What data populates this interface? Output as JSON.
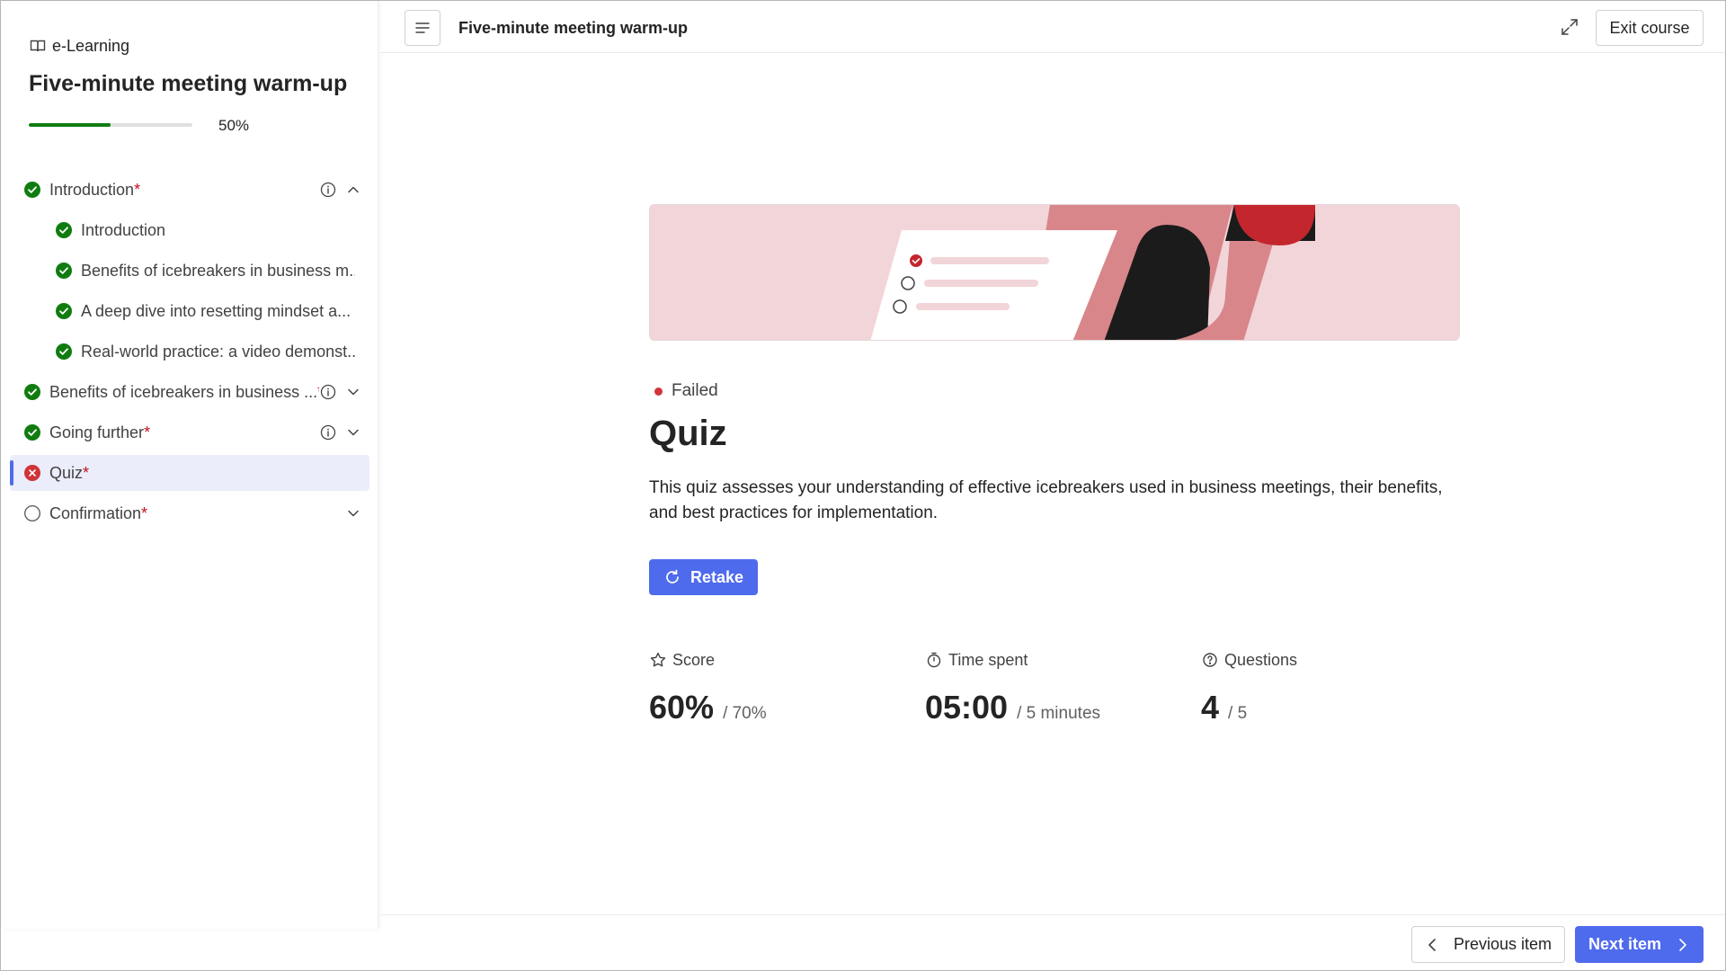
{
  "sidebar": {
    "brand_label": "e-Learning",
    "course_title": "Five-minute meeting warm-up",
    "progress_percent": 50,
    "progress_text": "50%",
    "items": [
      {
        "label": "Introduction",
        "required_mark": "*",
        "status": "completed",
        "level": 0,
        "has_info": true,
        "chevron": "up"
      },
      {
        "label": "Introduction",
        "required_mark": "",
        "status": "completed",
        "level": 1,
        "has_info": false,
        "chevron": ""
      },
      {
        "label": "Benefits of icebreakers in business m...",
        "required_mark": "",
        "status": "completed",
        "level": 1,
        "has_info": false,
        "chevron": ""
      },
      {
        "label": "A deep dive into resetting mindset a...",
        "required_mark": "",
        "status": "completed",
        "level": 1,
        "has_info": false,
        "chevron": ""
      },
      {
        "label": "Real-world practice: a video demonst...",
        "required_mark": "",
        "status": "completed",
        "level": 1,
        "has_info": false,
        "chevron": ""
      },
      {
        "label": "Benefits of icebreakers in business ...",
        "required_mark": "*",
        "status": "completed",
        "level": 0,
        "has_info": true,
        "chevron": "down"
      },
      {
        "label": "Going further",
        "required_mark": "*",
        "status": "completed",
        "level": 0,
        "has_info": true,
        "chevron": "down"
      },
      {
        "label": "Quiz",
        "required_mark": "*",
        "status": "failed",
        "level": 0,
        "has_info": false,
        "chevron": "",
        "selected": true
      },
      {
        "label": "Confirmation",
        "required_mark": "*",
        "status": "not-started",
        "level": 0,
        "has_info": false,
        "chevron": "down"
      }
    ]
  },
  "header": {
    "title": "Five-minute meeting warm-up",
    "exit_label": "Exit course"
  },
  "main": {
    "status_label": "Failed",
    "title": "Quiz",
    "description": "This quiz assesses your understanding of effective icebreakers used in business meetings, their benefits, and best practices for implementation.",
    "retake_label": "Retake",
    "stats": {
      "score": {
        "label": "Score",
        "value": "60%",
        "of": "/ 70%"
      },
      "time": {
        "label": "Time spent",
        "value": "05:00",
        "of": "/ 5 minutes"
      },
      "questions": {
        "label": "Questions",
        "value": "4",
        "of": "/ 5"
      }
    }
  },
  "footer": {
    "previous_label": "Previous item",
    "next_label": "Next item"
  },
  "colors": {
    "accent": "#4f6bed",
    "success": "#107c10",
    "danger": "#d13438",
    "required": "#c50f1f",
    "selected_bg": "#ebedfa"
  }
}
